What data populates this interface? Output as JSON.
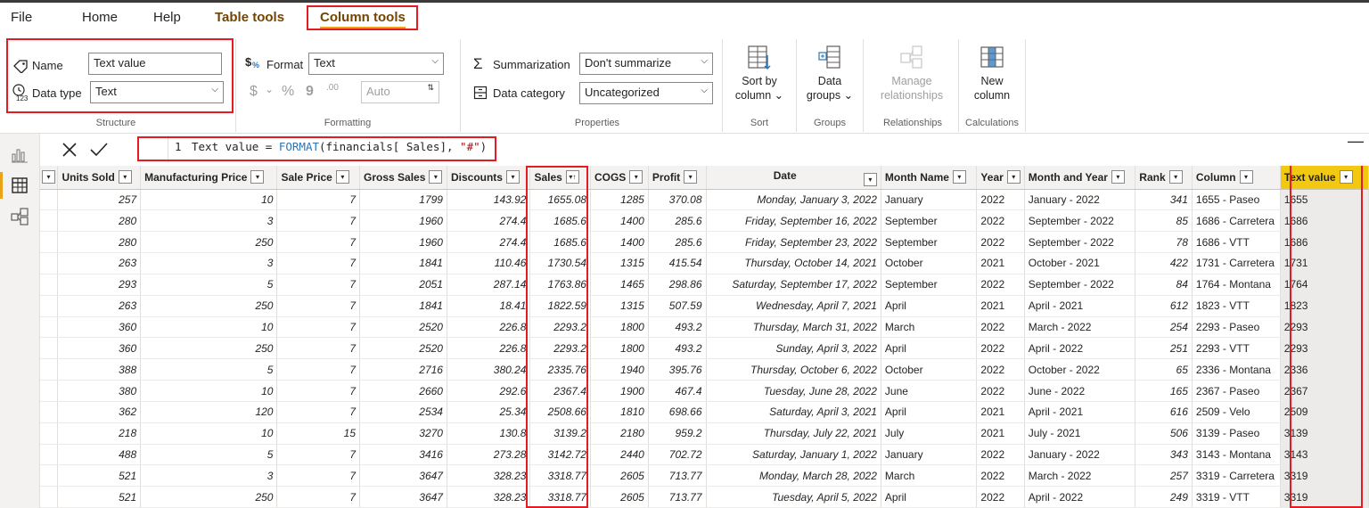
{
  "menu": {
    "tabs": [
      "File",
      "Home",
      "Help",
      "Table tools",
      "Column tools"
    ]
  },
  "ribbon": {
    "structure": {
      "name_label": "Name",
      "name_value": "Text value",
      "datatype_label": "Data type",
      "datatype_value": "Text",
      "group_label": "Structure"
    },
    "formatting": {
      "format_label": "Format",
      "format_value": "Text",
      "currency": "$",
      "dropdown": "⌄",
      "percent": "%",
      "comma": "9",
      "decimals": ".00",
      "auto_placeholder": "Auto",
      "group_label": "Formatting"
    },
    "properties": {
      "summarization_label": "Summarization",
      "summarization_value": "Don't summarize",
      "category_label": "Data category",
      "category_value": "Uncategorized",
      "group_label": "Properties"
    },
    "sort": {
      "line1": "Sort by",
      "line2": "column ⌄",
      "group_label": "Sort"
    },
    "groups": {
      "line1": "Data",
      "line2": "groups ⌄",
      "group_label": "Groups"
    },
    "relationships": {
      "line1": "Manage",
      "line2": "relationships",
      "group_label": "Relationships"
    },
    "calculations": {
      "line1": "New",
      "line2": "column",
      "group_label": "Calculations"
    }
  },
  "formula": {
    "line_number": "1",
    "part1": "Text value = ",
    "fn": "FORMAT",
    "part2": "(financials[ Sales], ",
    "str": "\"#\"",
    "part3": ")"
  },
  "table": {
    "columns": [
      "Units Sold",
      "Manufacturing Price",
      "Sale Price",
      "Gross Sales",
      "Discounts",
      "Sales",
      "COGS",
      "Profit",
      "Date",
      "Month Name",
      "Year",
      "Month and Year",
      "Rank",
      "Column",
      "Text value"
    ],
    "sort_glyph": "▾↑",
    "filter_glyph": "▾",
    "rows": [
      [
        "257",
        "10",
        "7",
        "1799",
        "143.92",
        "1655.08",
        "1285",
        "370.08",
        "Monday, January 3, 2022",
        "January",
        "2022",
        "January - 2022",
        "341",
        "1655 - Paseo",
        "1655"
      ],
      [
        "280",
        "3",
        "7",
        "1960",
        "274.4",
        "1685.6",
        "1400",
        "285.6",
        "Friday, September 16, 2022",
        "September",
        "2022",
        "September - 2022",
        "85",
        "1686 - Carretera",
        "1686"
      ],
      [
        "280",
        "250",
        "7",
        "1960",
        "274.4",
        "1685.6",
        "1400",
        "285.6",
        "Friday, September 23, 2022",
        "September",
        "2022",
        "September - 2022",
        "78",
        "1686 - VTT",
        "1686"
      ],
      [
        "263",
        "3",
        "7",
        "1841",
        "110.46",
        "1730.54",
        "1315",
        "415.54",
        "Thursday, October 14, 2021",
        "October",
        "2021",
        "October - 2021",
        "422",
        "1731 - Carretera",
        "1731"
      ],
      [
        "293",
        "5",
        "7",
        "2051",
        "287.14",
        "1763.86",
        "1465",
        "298.86",
        "Saturday, September 17, 2022",
        "September",
        "2022",
        "September - 2022",
        "84",
        "1764 - Montana",
        "1764"
      ],
      [
        "263",
        "250",
        "7",
        "1841",
        "18.41",
        "1822.59",
        "1315",
        "507.59",
        "Wednesday, April 7, 2021",
        "April",
        "2021",
        "April - 2021",
        "612",
        "1823 - VTT",
        "1823"
      ],
      [
        "360",
        "10",
        "7",
        "2520",
        "226.8",
        "2293.2",
        "1800",
        "493.2",
        "Thursday, March 31, 2022",
        "March",
        "2022",
        "March - 2022",
        "254",
        "2293 - Paseo",
        "2293"
      ],
      [
        "360",
        "250",
        "7",
        "2520",
        "226.8",
        "2293.2",
        "1800",
        "493.2",
        "Sunday, April 3, 2022",
        "April",
        "2022",
        "April - 2022",
        "251",
        "2293 - VTT",
        "2293"
      ],
      [
        "388",
        "5",
        "7",
        "2716",
        "380.24",
        "2335.76",
        "1940",
        "395.76",
        "Thursday, October 6, 2022",
        "October",
        "2022",
        "October - 2022",
        "65",
        "2336 - Montana",
        "2336"
      ],
      [
        "380",
        "10",
        "7",
        "2660",
        "292.6",
        "2367.4",
        "1900",
        "467.4",
        "Tuesday, June 28, 2022",
        "June",
        "2022",
        "June - 2022",
        "165",
        "2367 - Paseo",
        "2367"
      ],
      [
        "362",
        "120",
        "7",
        "2534",
        "25.34",
        "2508.66",
        "1810",
        "698.66",
        "Saturday, April 3, 2021",
        "April",
        "2021",
        "April - 2021",
        "616",
        "2509 - Velo",
        "2509"
      ],
      [
        "218",
        "10",
        "15",
        "3270",
        "130.8",
        "3139.2",
        "2180",
        "959.2",
        "Thursday, July 22, 2021",
        "July",
        "2021",
        "July - 2021",
        "506",
        "3139 - Paseo",
        "3139"
      ],
      [
        "488",
        "5",
        "7",
        "3416",
        "273.28",
        "3142.72",
        "2440",
        "702.72",
        "Saturday, January 1, 2022",
        "January",
        "2022",
        "January - 2022",
        "343",
        "3143 - Montana",
        "3143"
      ],
      [
        "521",
        "3",
        "7",
        "3647",
        "328.23",
        "3318.77",
        "2605",
        "713.77",
        "Monday, March 28, 2022",
        "March",
        "2022",
        "March - 2022",
        "257",
        "3319 - Carretera",
        "3319"
      ],
      [
        "521",
        "250",
        "7",
        "3647",
        "328.23",
        "3318.77",
        "2605",
        "713.77",
        "Tuesday, April 5, 2022",
        "April",
        "2022",
        "April - 2022",
        "249",
        "3319 - VTT",
        "3319"
      ]
    ]
  },
  "colors": {
    "accent": "#f2c811",
    "highlight_box": "#e31b23",
    "context_tab": "#744500"
  }
}
